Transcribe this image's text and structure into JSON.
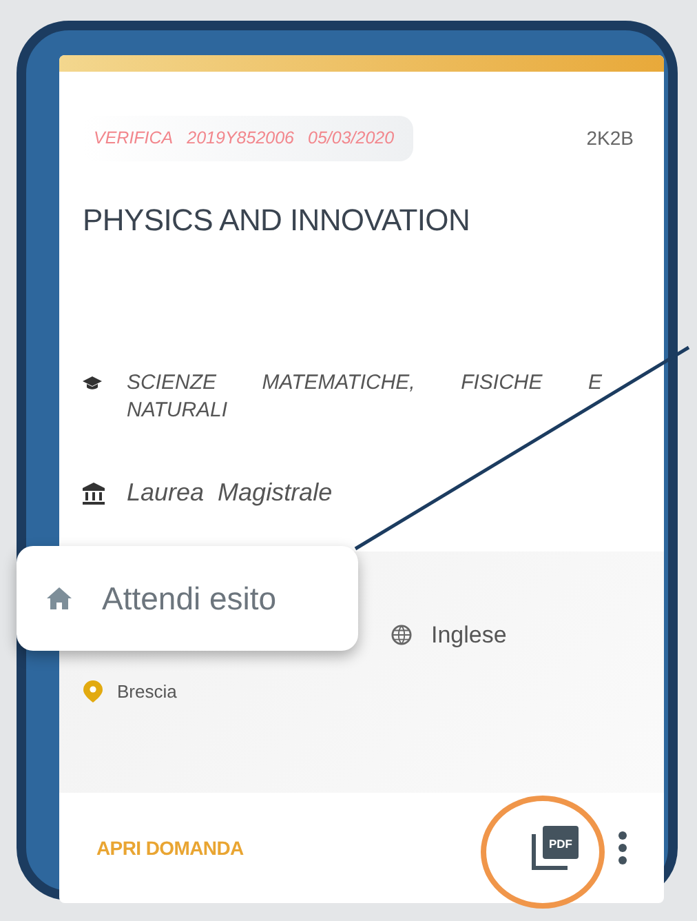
{
  "card": {
    "chip": {
      "label": "VERIFICA",
      "code": "2019Y852006",
      "date": "05/03/2020"
    },
    "class_code": "2K2B",
    "title": "PHYSICS AND INNOVATION",
    "department": "SCIENZE MATEMATICHE, FISICHE E NATURALI",
    "degree": "Laurea Magistrale",
    "language": "Inglese",
    "location": "Brescia",
    "open_label": "APRI DOMANDA",
    "pdf_label": "PDF"
  },
  "callout": {
    "status": "Attendi esito"
  }
}
